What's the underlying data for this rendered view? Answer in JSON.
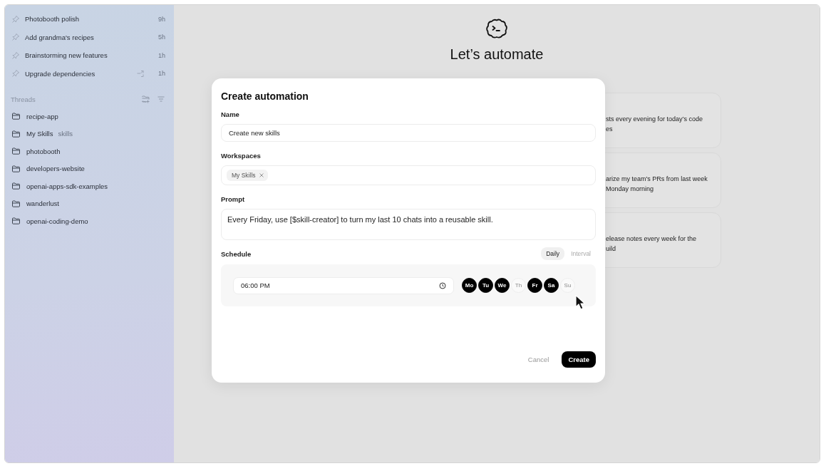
{
  "sidebar": {
    "pinned": [
      {
        "title": "Photobooth polish",
        "time": "9h",
        "kind": "plain"
      },
      {
        "title": "Add grandma's recipes",
        "time": "5h",
        "kind": "plain"
      },
      {
        "title": "Brainstorming new features",
        "time": "1h",
        "kind": "plain"
      },
      {
        "title": "Upgrade dependencies",
        "time": "1h",
        "kind": "with-action"
      }
    ],
    "threads_label": "Threads",
    "folders": [
      {
        "name": "recipe-app"
      },
      {
        "name": "My Skills",
        "tag": "skills"
      },
      {
        "name": "photobooth"
      },
      {
        "name": "developers-website"
      },
      {
        "name": "openai-apps-sdk-examples"
      },
      {
        "name": "wanderlust"
      },
      {
        "name": "openai-coding-demo"
      }
    ]
  },
  "hero": {
    "title": "Let’s automate"
  },
  "suggestions": [
    {
      "lines": [
        "sts every evening for today’s code",
        "es"
      ]
    },
    {
      "lines": [
        "arize my team's PRs from last week",
        "Monday morning"
      ]
    },
    {
      "lines": [
        "elease notes every week for the",
        "uild"
      ]
    }
  ],
  "modal": {
    "title": "Create automation",
    "name": {
      "label": "Name",
      "value": "Create new skills"
    },
    "workspaces": {
      "label": "Workspaces",
      "chips": [
        {
          "label": "My Skills"
        }
      ]
    },
    "prompt": {
      "label": "Prompt",
      "value": "Every Friday, use [$skill-creator] to turn my last 10 chats into a reusable skill."
    },
    "schedule": {
      "label": "Schedule",
      "modes": [
        {
          "label": "Daily",
          "selected": true
        },
        {
          "label": "Interval",
          "selected": false
        }
      ],
      "time": "06:00 PM",
      "days": [
        {
          "label": "Mo",
          "selected": true
        },
        {
          "label": "Tu",
          "selected": true
        },
        {
          "label": "We",
          "selected": true
        },
        {
          "label": "Th",
          "selected": false
        },
        {
          "label": "Fr",
          "selected": true
        },
        {
          "label": "Sa",
          "selected": true
        },
        {
          "label": "Su",
          "selected": false
        }
      ]
    },
    "buttons": {
      "cancel": "Cancel",
      "create": "Create"
    }
  }
}
